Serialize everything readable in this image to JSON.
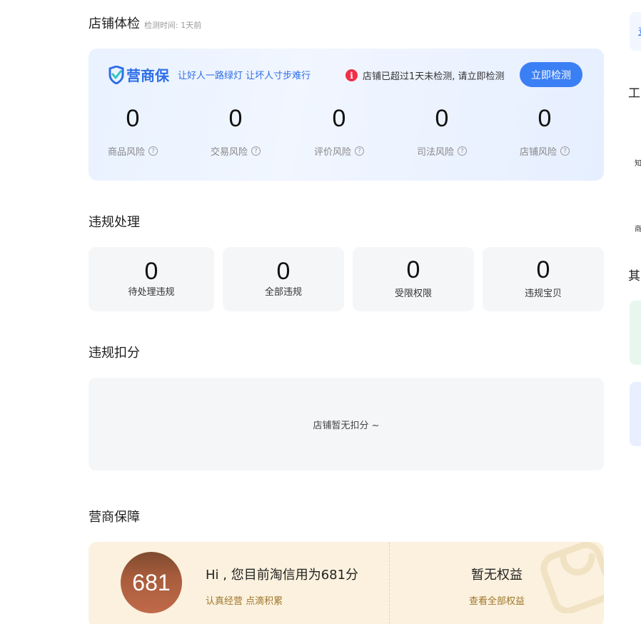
{
  "health": {
    "title": "店铺体检",
    "check_time": "检测时间: 1天前",
    "brand_name": "营商保",
    "slogan": "让好人一路绿灯 让坏人寸步难行",
    "warning": "店铺已超过1天未检测, 请立即检测",
    "check_button": "立即检测",
    "risks": [
      {
        "value": "0",
        "label": "商品风险"
      },
      {
        "value": "0",
        "label": "交易风险"
      },
      {
        "value": "0",
        "label": "评价风险"
      },
      {
        "value": "0",
        "label": "司法风险"
      },
      {
        "value": "0",
        "label": "店铺风险"
      }
    ]
  },
  "violation": {
    "title": "违规处理",
    "items": [
      {
        "value": "0",
        "label": "待处理违规"
      },
      {
        "value": "0",
        "label": "全部违规"
      },
      {
        "value": "0",
        "label": "受限权限"
      },
      {
        "value": "0",
        "label": "违规宝贝"
      }
    ]
  },
  "deduction": {
    "title": "违规扣分",
    "empty_text": "店铺暂无扣分 ~"
  },
  "guarantee": {
    "title": "营商保障",
    "score": "681",
    "greeting": "Hi , 您目前淘信用为681分",
    "motto": "认真经营 点滴积累",
    "no_benefit": "暂无权益",
    "view_all": "查看全部权益"
  },
  "right_panel": {
    "tool_heading": "工",
    "item_1": "知",
    "item_2": "商",
    "other_heading": "其",
    "link_char": "查"
  },
  "colors": {
    "accent": "#3b7ff5",
    "brand": "#2f6ee8",
    "warning": "#f22f4a",
    "score_gold": "#a0762c"
  }
}
